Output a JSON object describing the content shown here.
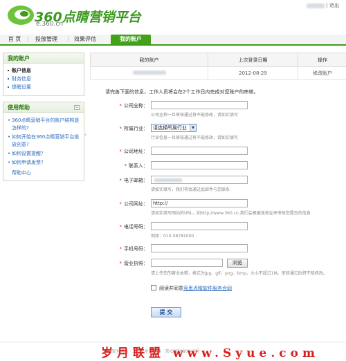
{
  "header": {
    "logo_text": "360点睛营销平台",
    "logo_sub": "e.360.cn",
    "user_suffix": "| 退出"
  },
  "topnav": {
    "tabs": [
      {
        "label": "首 页"
      },
      {
        "label": "投放管理"
      },
      {
        "label": "效果评估"
      },
      {
        "label": "我的账户"
      }
    ]
  },
  "sidebar": {
    "account_title": "我的账户",
    "account_items": [
      {
        "label": "账户信息"
      },
      {
        "label": "财务信息"
      },
      {
        "label": "提醒设置"
      }
    ],
    "help_title": "使用帮助",
    "help_items": [
      {
        "label": "360点睛营销平台的账户结构是怎样的?"
      },
      {
        "label": "如何开始在360点睛营销平台投放创意?"
      },
      {
        "label": "如何设置提醒?"
      },
      {
        "label": "如何申请发票?"
      }
    ],
    "help_center": "帮助中心"
  },
  "account_table": {
    "headers": [
      "我的账户",
      "上次登录日期",
      "操作"
    ],
    "row": {
      "last_login": "2012-08-29",
      "action": "修改账户"
    }
  },
  "notice": "请完善下面的信息，工作人员将会在2个工作日内完成对您账户的审核。",
  "form": {
    "company_name": {
      "label": "公司全称：",
      "hint": "公司全称一旦审核通过将不能修改，请如实填写"
    },
    "industry": {
      "label": "所属行业：",
      "value": "请选择所属行业",
      "hint": "行业信息一旦审核通过将不能修改，请如实填写"
    },
    "address": {
      "label": "公司地址："
    },
    "contact": {
      "label": "联系人："
    },
    "email": {
      "label": "电子邮箱：",
      "hint": "请如实填写，我们将会通过此邮件与您联系"
    },
    "website": {
      "label": "公司网址：",
      "value": "http://",
      "hint": "请如实填写网站的URL，如http://www.360.cn,我们会根据该地址来审核您提交的信息"
    },
    "phone": {
      "label": "电话号码：",
      "hint": "例如：010-58781000"
    },
    "mobile": {
      "label": "手机号码："
    },
    "license": {
      "label": "营业执照：",
      "browse": "浏览",
      "hint": "请上传您的营业执照，格式为jpg、gif、png、bmp，大小不超过1M。审核通过后将不能修改。"
    },
    "agree_text": "阅读并同意",
    "agree_link": "竞思点睛软件服务合同",
    "submit": "提 交"
  },
  "footer": {
    "text": "360安全网址 · 360安全浏览器 · 京ICP证080047号"
  },
  "watermark": "岁月联盟 www.Syue.com",
  "colors": {
    "brand_green": "#43a219",
    "link_blue": "#2a6bbd",
    "required_red": "#e02020"
  }
}
